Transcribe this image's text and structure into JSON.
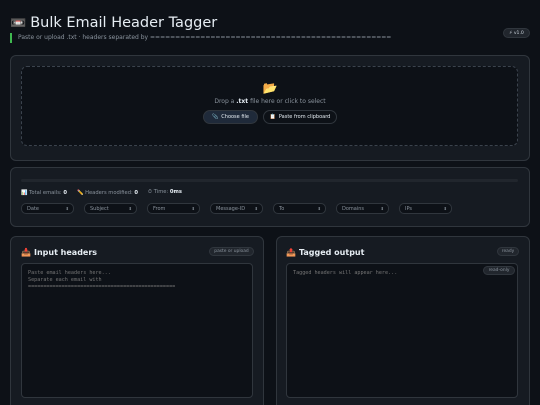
{
  "header": {
    "icon": "📼",
    "title": "Bulk Email Header Tagger",
    "subtitle": "Paste or upload .txt · headers separated by ================================================",
    "version": "⚡ v1.0"
  },
  "dropzone": {
    "icon": "📂",
    "text_before": "Drop a ",
    "text_bold": ".txt",
    "text_after": " file here or click to select",
    "choose_icon": "📎",
    "choose_label": "Choose file",
    "paste_icon": "📋",
    "paste_label": "Paste from clipboard"
  },
  "progress": {
    "percent": 0
  },
  "stats": {
    "total_icon": "📊",
    "total_label": "Total emails:",
    "total_value": "0",
    "modified_icon": "✏️",
    "modified_label": "Headers modified:",
    "modified_value": "0",
    "time_icon": "⏱",
    "time_label": "Time:",
    "time_value": "0ms"
  },
  "filters": [
    {
      "label": "Date"
    },
    {
      "label": "Subject"
    },
    {
      "label": "From"
    },
    {
      "label": "Message-ID"
    },
    {
      "label": "To"
    },
    {
      "label": "Domains"
    },
    {
      "label": "IPs"
    }
  ],
  "input_panel": {
    "icon": "📥",
    "title": "Input headers",
    "badge": "paste or upload",
    "placeholder": "Paste email headers here...\nSeparate each email with\n================================================"
  },
  "output_panel": {
    "icon": "📤",
    "title": "Tagged output",
    "badge": "ready",
    "readonly_badge": "read-only",
    "placeholder": "Tagged headers will appear here..."
  }
}
